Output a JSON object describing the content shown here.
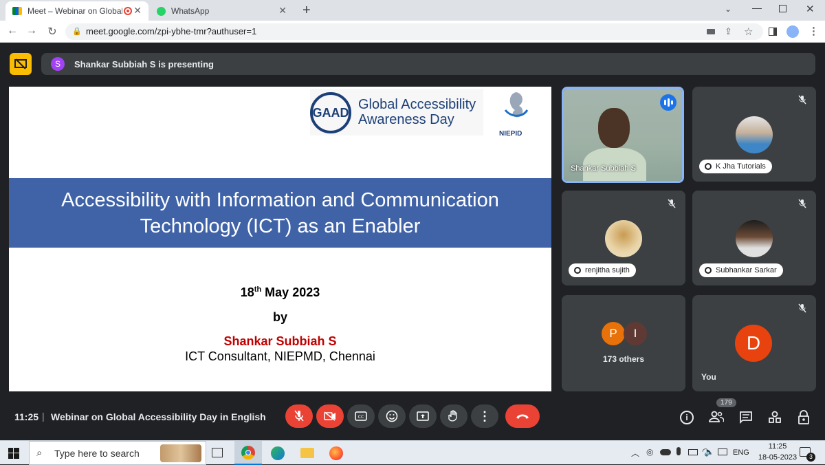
{
  "browser": {
    "tabs": [
      {
        "title": "Meet – Webinar on Global A",
        "active": true
      },
      {
        "title": "WhatsApp",
        "active": false
      }
    ],
    "url": "meet.google.com/zpi-ybhe-tmr?authuser=1"
  },
  "meet": {
    "presenting_avatar": "S",
    "presenting_text": "Shankar Subbiah S is presenting",
    "slide": {
      "logo_abbr": "GAAD",
      "logo_line1": "Global Accessibility",
      "logo_line2": "Awareness Day",
      "partner_logo": "NIEPID",
      "title_line1": "Accessibility with Information and Communication",
      "title_line2": "Technology (ICT) as an Enabler",
      "date_day": "18",
      "date_sup": "th",
      "date_rest": " May 2023",
      "by": "by",
      "presenter_name": "Shankar Subbiah S",
      "presenter_role": "ICT Consultant, NIEPMD, Chennai"
    },
    "participants": [
      {
        "name": "Shankar Subbiah S",
        "speaking": true
      },
      {
        "name": "K Jha Tutorials",
        "muted": true
      },
      {
        "name": "renjitha sujith",
        "muted": true
      },
      {
        "name": "Subhankar Sarkar",
        "muted": true
      },
      {
        "initials": [
          "P",
          "I"
        ],
        "others_label": "173 others"
      },
      {
        "name": "You",
        "initial": "D",
        "muted": true
      }
    ],
    "footer": {
      "time": "11:25",
      "separator": "|",
      "meeting_title": "Webinar on Global Accessibility Day in English",
      "participant_count": "179"
    },
    "colors": {
      "accent_red": "#ea4335",
      "control_gray": "#3c4043",
      "slide_band": "#4063a8",
      "presenter_name": "#c00000"
    }
  },
  "taskbar": {
    "search_placeholder": "Type here to search",
    "language": "ENG",
    "clock_time": "11:25",
    "clock_date": "18-05-2023",
    "notification_count": "3"
  }
}
